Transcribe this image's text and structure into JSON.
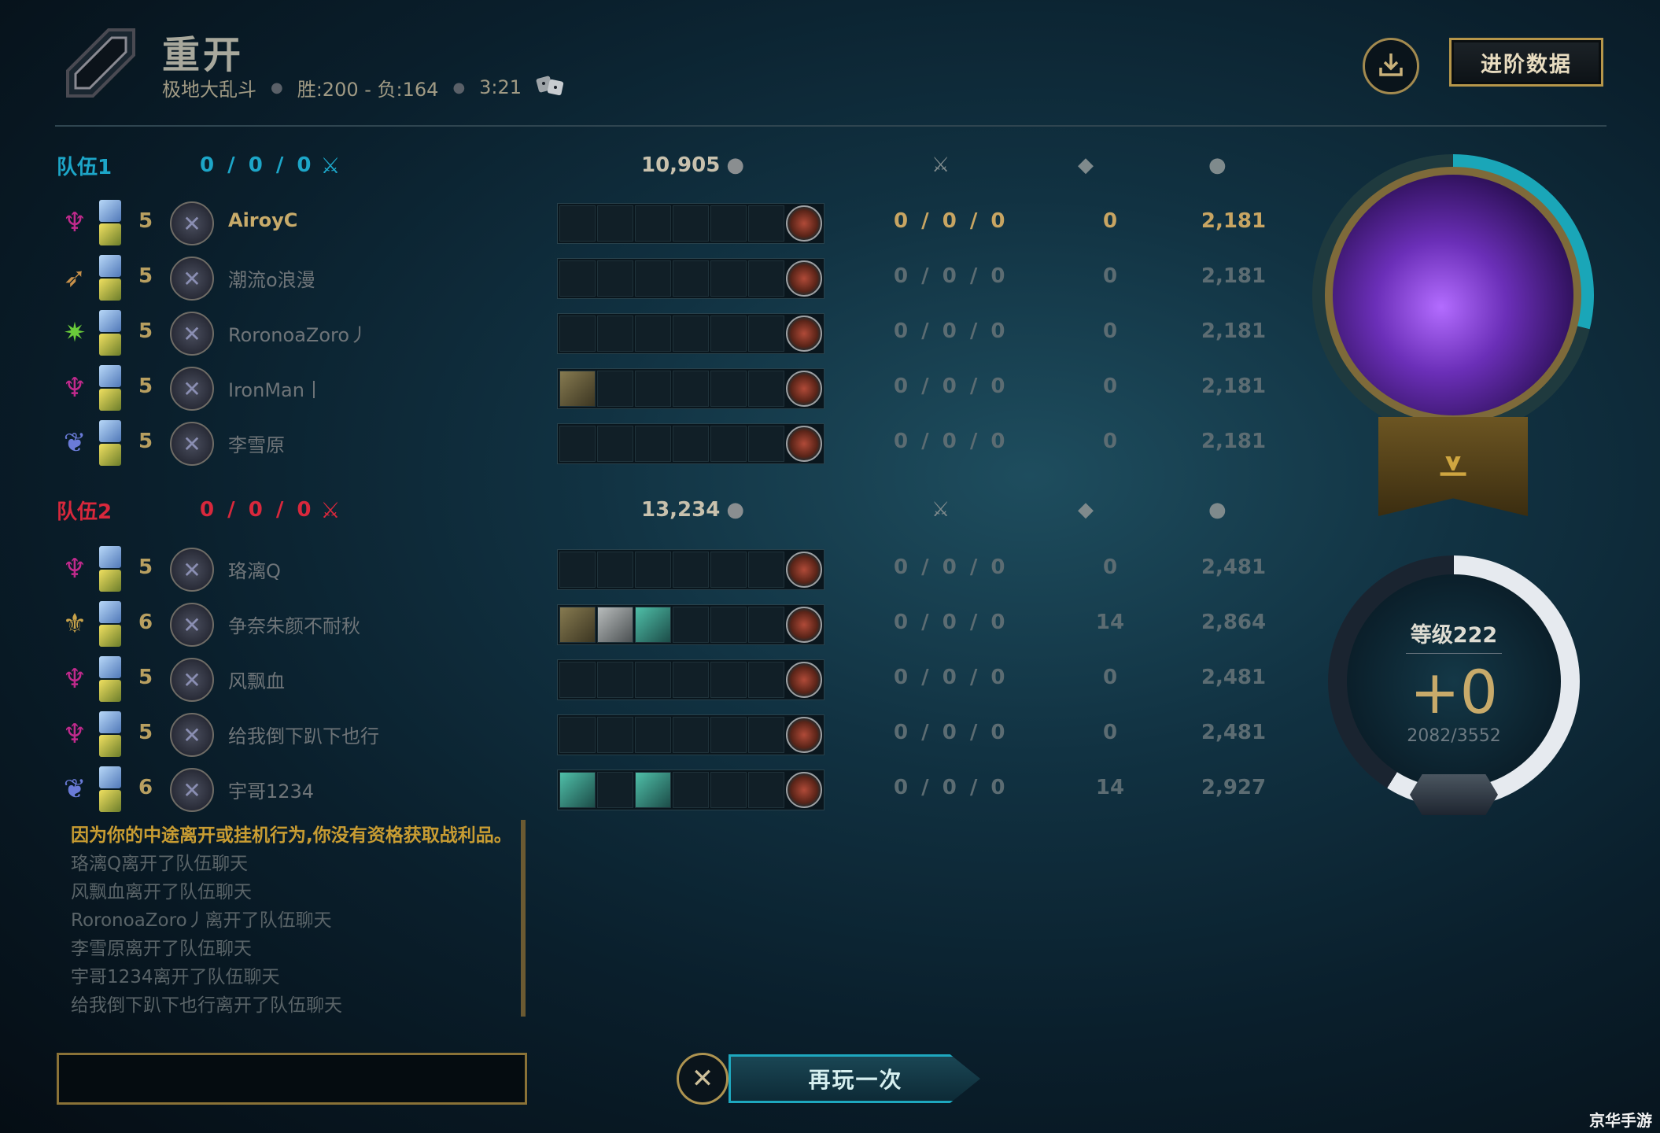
{
  "header": {
    "title": "重开",
    "mode": "极地大乱斗",
    "record": "胜:200 - 负:164",
    "duration": "3:21",
    "advanced_stats_label": "进阶数据"
  },
  "teams": [
    {
      "name": "队伍1",
      "kda": "0 / 0 / 0",
      "gold": "10,905",
      "players": [
        {
          "name": "AiroyC",
          "level": "5",
          "champion": "purple-hooded-icon",
          "kda": "0 / 0 / 0",
          "cs": "0",
          "gold": "2,181",
          "self": true
        },
        {
          "name": "潮流o浪漫",
          "level": "5",
          "champion": "winged-icon",
          "kda": "0 / 0 / 0",
          "cs": "0",
          "gold": "2,181"
        },
        {
          "name": "RoronoaZoro丿",
          "level": "5",
          "champion": "green-star-icon",
          "kda": "0 / 0 / 0",
          "cs": "0",
          "gold": "2,181"
        },
        {
          "name": "IronMan丨",
          "level": "5",
          "champion": "purple-hooded-icon",
          "kda": "0 / 0 / 0",
          "cs": "0",
          "gold": "2,181"
        },
        {
          "name": "李雪原",
          "level": "5",
          "champion": "blue-feather-icon",
          "kda": "0 / 0 / 0",
          "cs": "0",
          "gold": "2,181"
        }
      ]
    },
    {
      "name": "队伍2",
      "kda": "0 / 0 / 0",
      "gold": "13,234",
      "players": [
        {
          "name": "珞漓Q",
          "level": "5",
          "champion": "purple-hooded-icon",
          "kda": "0 / 0 / 0",
          "cs": "0",
          "gold": "2,481"
        },
        {
          "name": "争奈朱颜不耐秋",
          "level": "6",
          "champion": "golden-sword-icon",
          "kda": "0 / 0 / 0",
          "cs": "14",
          "gold": "2,864"
        },
        {
          "name": "风飘血",
          "level": "5",
          "champion": "purple-hooded-icon",
          "kda": "0 / 0 / 0",
          "cs": "0",
          "gold": "2,481"
        },
        {
          "name": "给我倒下趴下也行",
          "level": "5",
          "champion": "purple-hooded-icon",
          "kda": "0 / 0 / 0",
          "cs": "0",
          "gold": "2,481"
        },
        {
          "name": "宇哥1234",
          "level": "6",
          "champion": "blue-feather-icon",
          "kda": "0 / 0 / 0",
          "cs": "14",
          "gold": "2,927"
        }
      ]
    }
  ],
  "chat": {
    "warning": "因为你的中途离开或挂机行为,你没有资格获取战利品。",
    "lines": [
      "珞漓Q离开了队伍聊天",
      "风飘血离开了队伍聊天",
      "RoronoaZoro丿离开了队伍聊天",
      "李雪原离开了队伍聊天",
      "宇哥1234离开了队伍聊天",
      "给我倒下趴下也行离开了队伍聊天"
    ]
  },
  "play_again_label": "再玩一次",
  "progress": {
    "level_label": "等级222",
    "gain": "+0",
    "xp": "2082/3552",
    "xp_fraction": 0.586
  },
  "watermark": "京华手游",
  "colors": {
    "team1": "#1da6c8",
    "team2": "#d8283c",
    "gold_accent": "#c8aa6e",
    "teal_accent": "#1ea8bf"
  }
}
